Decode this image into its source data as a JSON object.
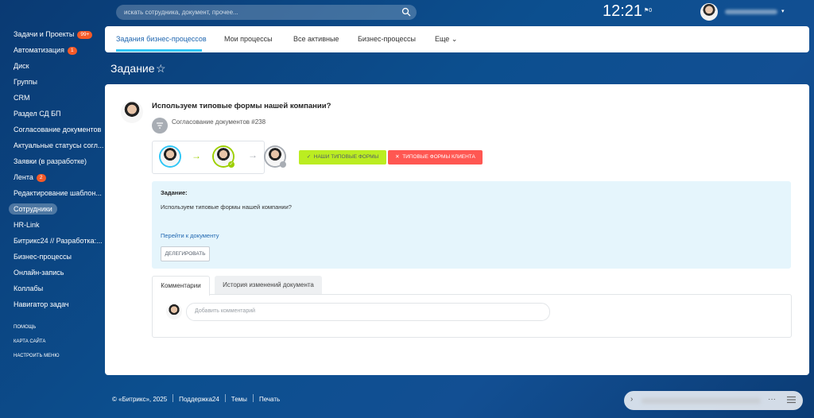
{
  "header": {
    "search_placeholder": "искать сотрудника, документ, прочее...",
    "clock": "12:21",
    "flag_label": "⚑0"
  },
  "sidebar": {
    "items": [
      {
        "label": "Задачи и Проекты",
        "badge": "99+"
      },
      {
        "label": "Автоматизация",
        "badge": "1"
      },
      {
        "label": "Диск"
      },
      {
        "label": "Группы"
      },
      {
        "label": "CRM"
      },
      {
        "label": "Раздел СД БП"
      },
      {
        "label": "Согласование документов"
      },
      {
        "label": "Актуальные статусы согл..."
      },
      {
        "label": "Заявки (в разработке)"
      },
      {
        "label": "Лента",
        "badge": "2"
      },
      {
        "label": "Редактирование шаблон..."
      },
      {
        "label": "Сотрудники",
        "active": true
      },
      {
        "label": "HR-Link"
      },
      {
        "label": "Битрикс24 // Разработка:..."
      },
      {
        "label": "Бизнес-процессы"
      },
      {
        "label": "Онлайн-запись"
      },
      {
        "label": "Коллабы"
      },
      {
        "label": "Навигатор задач"
      }
    ],
    "small_links": [
      "помощь",
      "карта сайта",
      "настроить меню"
    ]
  },
  "tabs": {
    "items": [
      "Задания бизнес-процессов",
      "Мои процессы",
      "Все активные",
      "Бизнес-процессы",
      "Еще"
    ],
    "active_index": 0
  },
  "page": {
    "title": "Задание",
    "star": "☆"
  },
  "task": {
    "title": "Используем типовые формы нашей компании?",
    "document_ref": "Согласование документов #238",
    "approve_label": "Наши типовые формы",
    "reject_label": "Типовые формы клиента",
    "info_label": "Задание:",
    "info_text": "Используем типовые формы нашей компании?",
    "doc_link": "Перейти к документу",
    "delegate_label": "Делегировать"
  },
  "comments": {
    "tab_comments": "Комментарии",
    "tab_history": "История изменений документа",
    "placeholder": "Добавить комментарий"
  },
  "footer": {
    "copyright": "© «Битрикс», 2025",
    "support": "Поддержка24",
    "themes": "Темы",
    "print": "Печать"
  },
  "colors": {
    "accent_blue": "#2fc6f6",
    "approve_green": "#bbed21",
    "reject_red": "#ff5752",
    "badge_orange": "#f55a28"
  }
}
